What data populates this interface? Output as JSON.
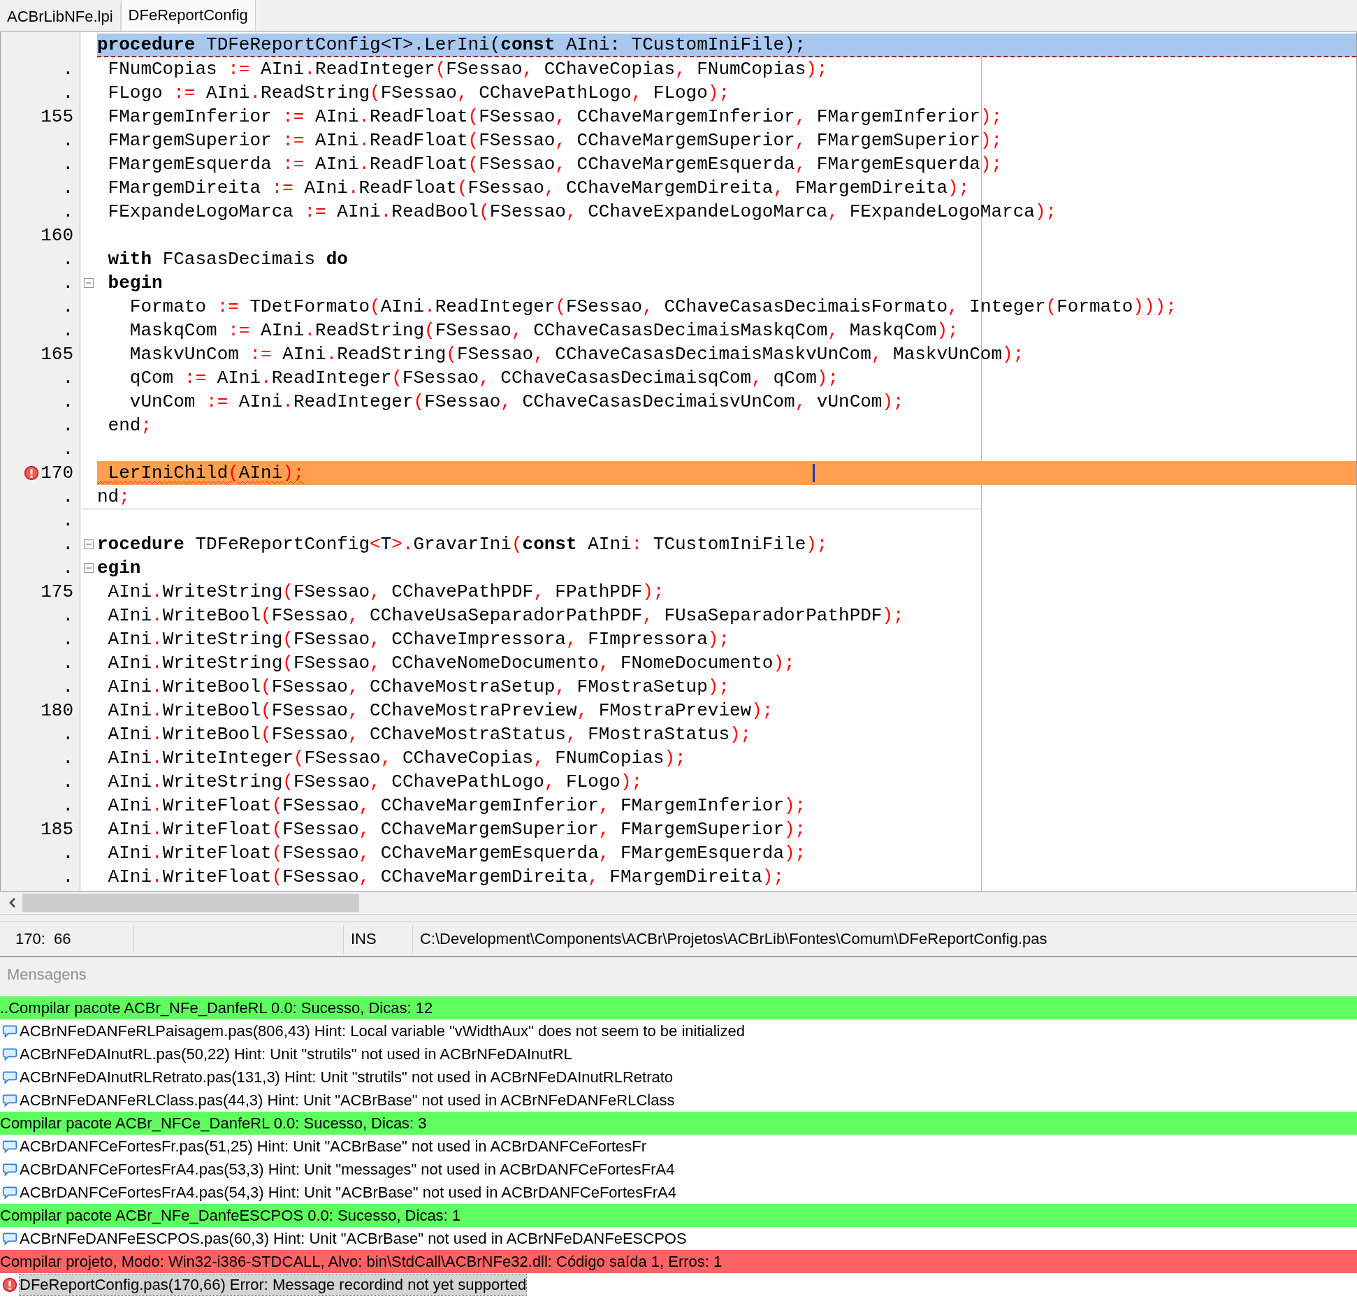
{
  "tabs": [
    {
      "label": "ACBrLibNFe.lpi",
      "selected": false
    },
    {
      "label": "DFeReportConfig",
      "selected": true
    }
  ],
  "editor": {
    "lines": [
      {
        "text": "**procedure** TDFeReportConfig<T>.LerIni(**const** AIni: TCustomIniFile);",
        "kind": "header",
        "fold": false
      },
      {
        "number": ".",
        "text": " FNumCopias := AIni.ReadInteger(FSessao, CChaveCopias, FNumCopias);",
        "kind": "code",
        "fold": false
      },
      {
        "number": ".",
        "text": " FLogo := AIni.ReadString(FSessao, CChavePathLogo, FLogo);",
        "kind": "code",
        "fold": false
      },
      {
        "number": "155",
        "text": " FMargemInferior := AIni.ReadFloat(FSessao, CChaveMargemInferior, FMargemInferior);",
        "kind": "code",
        "fold": false
      },
      {
        "number": ".",
        "text": " FMargemSuperior := AIni.ReadFloat(FSessao, CChaveMargemSuperior, FMargemSuperior);",
        "kind": "code",
        "fold": false
      },
      {
        "number": ".",
        "text": " FMargemEsquerda := AIni.ReadFloat(FSessao, CChaveMargemEsquerda, FMargemEsquerda);",
        "kind": "code",
        "fold": false
      },
      {
        "number": ".",
        "text": " FMargemDireita := AIni.ReadFloat(FSessao, CChaveMargemDireita, FMargemDireita);",
        "kind": "code",
        "fold": false
      },
      {
        "number": ".",
        "text": " FExpandeLogoMarca := AIni.ReadBool(FSessao, CChaveExpandeLogoMarca, FExpandeLogoMarca);",
        "kind": "code",
        "fold": false
      },
      {
        "number": "160",
        "kind": "code",
        "fold": false
      },
      {
        "number": ".",
        "text": " **with** FCasasDecimais **do**",
        "kind": "code",
        "fold": false
      },
      {
        "number": ".",
        "text": " **begin**",
        "kind": "code",
        "fold": true
      },
      {
        "number": ".",
        "text": "   Formato := TDetFormato(AIni.ReadInteger(FSessao, CChaveCasasDecimaisFormato, Integer(Formato)));",
        "kind": "code",
        "fold": false
      },
      {
        "number": ".",
        "text": "   MaskqCom := AIni.ReadString(FSessao, CChaveCasasDecimaisMaskqCom, MaskqCom);",
        "kind": "code",
        "fold": false
      },
      {
        "number": "165",
        "text": "   MaskvUnCom := AIni.ReadString(FSessao, CChaveCasasDecimaisMaskvUnCom, MaskvUnCom);",
        "kind": "code",
        "fold": false
      },
      {
        "number": ".",
        "text": "   qCom := AIni.ReadInteger(FSessao, CChaveCasasDecimaisqCom, qCom);",
        "kind": "code",
        "fold": false
      },
      {
        "number": ".",
        "text": "   vUnCom := AIni.ReadInteger(FSessao, CChaveCasasDecimaisvUnCom, vUnCom);",
        "kind": "code",
        "fold": false
      },
      {
        "number": ".",
        "text": " end;",
        "kind": "code",
        "fold": false
      },
      {
        "number": ".",
        "kind": "code",
        "fold": false
      },
      {
        "number": "170",
        "text": " LerIniChild(AIni);",
        "kind": "error",
        "fold": false
      },
      {
        "number": ".",
        "text": "nd;",
        "kind": "code",
        "fold": false
      },
      {
        "number": ".",
        "kind": "code",
        "fold": false
      },
      {
        "number": ".",
        "text": "**rocedure** TDFeReportConfig<T>.GravarIni(**const** AIni: TCustomIniFile);",
        "kind": "code",
        "fold": true
      },
      {
        "number": ".",
        "text": "**egin**",
        "kind": "code",
        "fold": true
      },
      {
        "number": "175",
        "text": " AIni.WriteString(FSessao, CChavePathPDF, FPathPDF);",
        "kind": "code",
        "fold": false
      },
      {
        "number": ".",
        "text": " AIni.WriteBool(FSessao, CChaveUsaSeparadorPathPDF, FUsaSeparadorPathPDF);",
        "kind": "code",
        "fold": false
      },
      {
        "number": ".",
        "text": " AIni.WriteString(FSessao, CChaveImpressora, FImpressora);",
        "kind": "code",
        "fold": false
      },
      {
        "number": ".",
        "text": " AIni.WriteString(FSessao, CChaveNomeDocumento, FNomeDocumento);",
        "kind": "code",
        "fold": false
      },
      {
        "number": ".",
        "text": " AIni.WriteBool(FSessao, CChaveMostraSetup, FMostraSetup);",
        "kind": "code",
        "fold": false
      },
      {
        "number": "180",
        "text": " AIni.WriteBool(FSessao, CChaveMostraPreview, FMostraPreview);",
        "kind": "code",
        "fold": false
      },
      {
        "number": ".",
        "text": " AIni.WriteBool(FSessao, CChaveMostraStatus, FMostraStatus);",
        "kind": "code",
        "fold": false
      },
      {
        "number": ".",
        "text": " AIni.WriteInteger(FSessao, CChaveCopias, FNumCopias);",
        "kind": "code",
        "fold": false
      },
      {
        "number": ".",
        "text": " AIni.WriteString(FSessao, CChavePathLogo, FLogo);",
        "kind": "code",
        "fold": false
      },
      {
        "number": ".",
        "text": " AIni.WriteFloat(FSessao, CChaveMargemInferior, FMargemInferior);",
        "kind": "code",
        "fold": false
      },
      {
        "number": "185",
        "text": " AIni.WriteFloat(FSessao, CChaveMargemSuperior, FMargemSuperior);",
        "kind": "code",
        "fold": false
      },
      {
        "number": ".",
        "text": " AIni.WriteFloat(FSessao, CChaveMargemEsquerda, FMargemEsquerda);",
        "kind": "code",
        "fold": false
      },
      {
        "number": ".",
        "text": " AIni.WriteFloat(FSessao, CChaveMargemDireita, FMargemDireita);",
        "kind": "code",
        "fold": false
      }
    ]
  },
  "status_bar": {
    "position": "170:  66",
    "mode": "INS",
    "path": "C:\\Development\\Components\\ACBr\\Projetos\\ACBrLib\\Fontes\\Comum\\DFeReportConfig.pas"
  },
  "messages": {
    "title": "Mensagens",
    "items": [
      {
        "kind": "group",
        "color": "#5eff5e",
        "text": "..Compilar pacote ACBr_NFe_DanfeRL 0.0: Sucesso, Dicas: 12",
        "selected": false
      },
      {
        "kind": "hint",
        "text": "ACBrNFeDANFeRLPaisagem.pas(806,43) Hint: Local variable \"vWidthAux\" does not seem to be initialized",
        "selected": false
      },
      {
        "kind": "hint",
        "text": "ACBrNFeDAInutRL.pas(50,22) Hint: Unit \"strutils\" not used in ACBrNFeDAInutRL",
        "selected": false
      },
      {
        "kind": "hint",
        "text": "ACBrNFeDAInutRLRetrato.pas(131,3) Hint: Unit \"strutils\" not used in ACBrNFeDAInutRLRetrato",
        "selected": false
      },
      {
        "kind": "hint",
        "text": "ACBrNFeDANFeRLClass.pas(44,3) Hint: Unit \"ACBrBase\" not used in ACBrNFeDANFeRLClass",
        "selected": false
      },
      {
        "kind": "group",
        "color": "#5eff5e",
        "text": "Compilar pacote ACBr_NFCe_DanfeRL 0.0: Sucesso, Dicas: 3",
        "selected": false
      },
      {
        "kind": "hint",
        "text": "ACBrDANFCeFortesFr.pas(51,25) Hint: Unit \"ACBrBase\" not used in ACBrDANFCeFortesFr",
        "selected": false
      },
      {
        "kind": "hint",
        "text": "ACBrDANFCeFortesFrA4.pas(53,3) Hint: Unit \"messages\" not used in ACBrDANFCeFortesFrA4",
        "selected": false
      },
      {
        "kind": "hint",
        "text": "ACBrDANFCeFortesFrA4.pas(54,3) Hint: Unit \"ACBrBase\" not used in ACBrDANFCeFortesFrA4",
        "selected": false
      },
      {
        "kind": "group",
        "color": "#5eff5e",
        "text": "Compilar pacote ACBr_NFe_DanfeESCPOS 0.0: Sucesso, Dicas: 1",
        "selected": false
      },
      {
        "kind": "hint",
        "text": "ACBrNFeDANFeESCPOS.pas(60,3) Hint: Unit \"ACBrBase\" not used in ACBrNFeDANFeESCPOS",
        "selected": false
      },
      {
        "kind": "group",
        "color": "#ff6262",
        "text": "Compilar projeto, Modo: Win32-i386-STDCALL, Alvo: bin\\StdCall\\ACBrNFe32.dll: Código saída 1, Erros: 1",
        "selected": false
      },
      {
        "kind": "error",
        "text": "DFeReportConfig.pas(170,66) Error: Message recordind not yet supported",
        "selected": true
      }
    ]
  }
}
